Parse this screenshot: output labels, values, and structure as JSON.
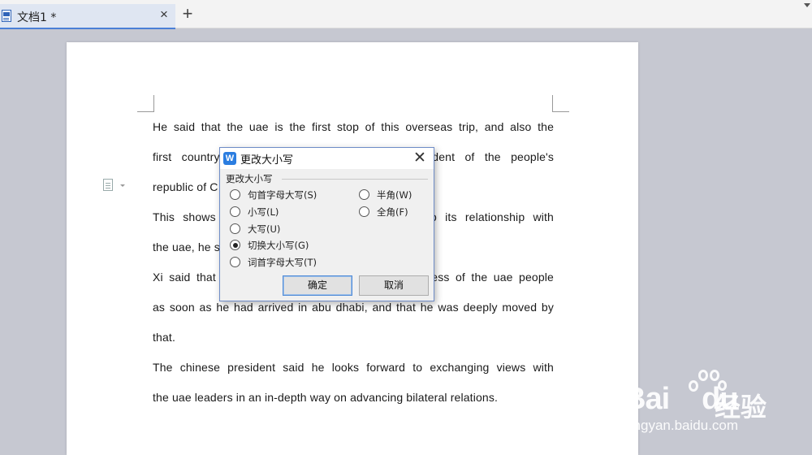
{
  "tabbar": {
    "tab_title": "文档1 *",
    "close_glyph": "×",
    "new_tab_glyph": "+"
  },
  "document": {
    "paragraphs": [
      [
        "He said that the uae is the first stop of this overseas trip, and also the",
        "first country ",
        "ident of the people's",
        "republic of C"
      ],
      [
        "This shows t",
        "o its relationship with",
        "the uae, he s"
      ],
      [
        "Xi said that h",
        "ess of the uae people",
        "as soon as he had arrived in abu dhabi, and that he was deeply moved by",
        "that."
      ],
      [
        "The chinese president said he looks forward to exchanging views with",
        "the uae leaders in an in-depth way on advancing bilateral relations."
      ]
    ]
  },
  "dialog": {
    "logo_letter": "W",
    "title": "更改大小写",
    "close_glyph": "✕",
    "group_label": "更改大小写",
    "options_left": [
      {
        "label": "句首字母大写(S)",
        "selected": false
      },
      {
        "label": "小写(L)",
        "selected": false
      },
      {
        "label": "大写(U)",
        "selected": false
      },
      {
        "label": "切换大小写(G)",
        "selected": true
      },
      {
        "label": "词首字母大写(T)",
        "selected": false
      }
    ],
    "options_right": [
      {
        "label": "半角(W)",
        "selected": false
      },
      {
        "label": "全角(F)",
        "selected": false
      }
    ],
    "ok_label": "确定",
    "cancel_label": "取消"
  },
  "watermark": {
    "brand_latin": "Bai",
    "brand_latin2": "du",
    "brand_cn": "经验",
    "url": "jingyan.baidu.com"
  },
  "colors": {
    "accent": "#4a7fd6",
    "workspace": "#c6c8d1",
    "logo": "#2b7de0"
  }
}
